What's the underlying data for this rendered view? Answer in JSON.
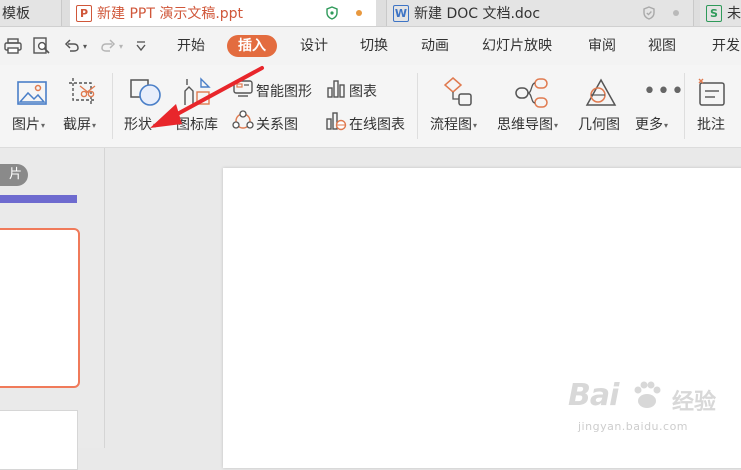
{
  "tabs": [
    {
      "label": "模板",
      "icon": "",
      "state": "inactive"
    },
    {
      "label": "新建 PPT 演示文稿.ppt",
      "icon": "P",
      "state": "active",
      "status_icon": "shield-icon",
      "dot_color": "#e8983e"
    },
    {
      "label": "新建 DOC 文档.doc",
      "icon": "W",
      "status_icon": "shield-icon",
      "dot_color": "#b9b9b9"
    },
    {
      "label": "未",
      "icon": "S"
    }
  ],
  "menu": {
    "items": [
      "开始",
      "插入",
      "设计",
      "切换",
      "动画",
      "幻灯片放映",
      "审阅",
      "视图",
      "开发"
    ],
    "active": "插入"
  },
  "ribbon": {
    "picture": "图片",
    "screenshot": "截屏",
    "shape": "形状",
    "icon_library": "图标库",
    "smart_graphic": "智能图形",
    "relation_graph": "关系图",
    "chart": "图表",
    "online_chart": "在线图表",
    "flowchart": "流程图",
    "mindmap": "思维导图",
    "geometry": "几何图",
    "more": "更多",
    "comment": "批注"
  },
  "left_panel": {
    "label": "片"
  },
  "watermark": {
    "logo": "Bai",
    "text": "经验",
    "url": "jingyan.baidu.com"
  },
  "colors": {
    "accent": "#e36c3f",
    "active_tab_text": "#d0573a",
    "thumbnail_border": "#f07a5a",
    "progress": "#6e6bcf",
    "annotation_arrow": "#e8262b"
  }
}
